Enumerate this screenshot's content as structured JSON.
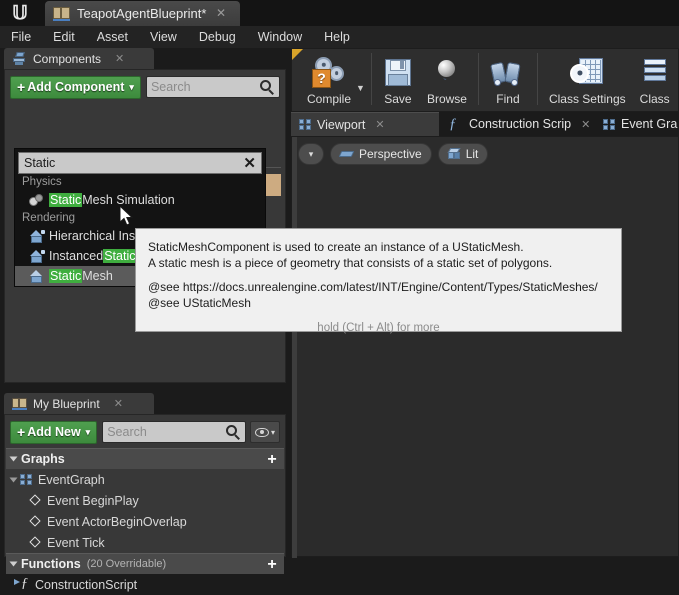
{
  "window": {
    "logo_icon": "unreal-logo",
    "tab": {
      "label": "TeapotAgentBlueprint*",
      "icon": "blueprint-icon",
      "close": "✕"
    }
  },
  "menubar": {
    "items": [
      "File",
      "Edit",
      "Asset",
      "View",
      "Debug",
      "Window",
      "Help"
    ]
  },
  "toolbar": {
    "items": [
      {
        "label": "Compile",
        "icon": "compile-gear-question-icon",
        "has_dropdown": true
      },
      {
        "label": "Save",
        "icon": "save-floppy-icon"
      },
      {
        "label": "Browse",
        "icon": "browse-magnifier-icon"
      },
      {
        "label": "Find",
        "icon": "find-binoculars-icon"
      },
      {
        "label": "Class Settings",
        "icon": "class-settings-gear-icon"
      },
      {
        "label": "Class",
        "icon": "class-defaults-stack-icon"
      }
    ]
  },
  "components_panel": {
    "tab_label": "Components",
    "tab_icon": "components-icon",
    "tab_close": "✕",
    "add_component_label": "Add Component",
    "add_component_plus": "+",
    "add_component_caret": "▾",
    "search_placeholder": "Search",
    "search_icon": "magnifier-icon",
    "dropdown": {
      "filter_value": "Static",
      "clear_label": "✕",
      "highlight_term": "Static",
      "groups": [
        {
          "category": "Physics",
          "entries": [
            {
              "icon": "mesh-simulation-icon",
              "pre": "",
              "hl": "Static",
              "post": " Mesh Simulation",
              "selected": false
            }
          ]
        },
        {
          "category": "Rendering",
          "entries": [
            {
              "icon": "instanced-static-mesh-icon",
              "pre": "Hierarchical Instanced ",
              "hl": "Static",
              "post": " Mesh",
              "selected": false
            },
            {
              "icon": "instanced-static-mesh-icon",
              "pre": "Instanced ",
              "hl": "Static",
              "post": " Mesh",
              "selected": false
            },
            {
              "icon": "static-mesh-icon",
              "pre": "",
              "hl": "Static",
              "post": " Mesh",
              "selected": true
            }
          ]
        }
      ]
    }
  },
  "tooltip": {
    "line1": "StaticMeshComponent is used to create an instance of a UStaticMesh.",
    "line2": "A static mesh is a piece of geometry that consists of a static set of polygons.",
    "line3": "@see https://docs.unrealengine.com/latest/INT/Engine/Content/Types/StaticMeshes/",
    "line4": "@see UStaticMesh",
    "hint": "hold (Ctrl + Alt) for more"
  },
  "viewport_tabs": {
    "tabs": [
      {
        "label": "Viewport",
        "icon": "viewport-grid-icon",
        "active": true,
        "close": "✕"
      },
      {
        "label": "Construction Scrip",
        "icon": "function-fx-icon",
        "active": false,
        "close": "✕"
      },
      {
        "label": "Event Gra",
        "icon": "event-graph-icon",
        "active": false,
        "close": ""
      }
    ]
  },
  "viewport_toolbar": {
    "menu_caret": "▾",
    "view_mode": "Perspective",
    "view_mode_icon": "perspective-icon",
    "lighting_mode": "Lit",
    "lighting_mode_icon": "lit-cube-icon"
  },
  "my_blueprint_panel": {
    "tab_label": "My Blueprint",
    "tab_icon": "blueprint-book-icon",
    "tab_close": "✕",
    "add_new_label": "Add New",
    "add_new_plus": "+",
    "add_new_caret": "▾",
    "search_placeholder": "Search",
    "search_icon": "magnifier-icon",
    "visibility_icon": "eye-icon",
    "visibility_caret": "▾",
    "sections": [
      {
        "title": "Graphs",
        "subtitle": "",
        "add_label": "+",
        "items": [
          {
            "label": "EventGraph",
            "icon": "event-graph-icon",
            "indent": 0,
            "expander": true
          },
          {
            "label": "Event BeginPlay",
            "icon": "event-node-icon",
            "indent": 1,
            "expander": false
          },
          {
            "label": "Event ActorBeginOverlap",
            "icon": "event-node-icon",
            "indent": 1,
            "expander": false
          },
          {
            "label": "Event Tick",
            "icon": "event-node-icon",
            "indent": 1,
            "expander": false
          }
        ]
      },
      {
        "title": "Functions",
        "subtitle": "(20 Overridable)",
        "add_label": "+",
        "items": [
          {
            "label": "ConstructionScript",
            "icon": "function-icon",
            "indent": 0,
            "expander": false
          }
        ]
      }
    ]
  },
  "colors": {
    "accent_green": "#3d8b3d",
    "highlight_green": "#3fae3f",
    "warning_orange": "#d9a42a",
    "panel_bg": "#383838",
    "window_bg": "#1b1b1b",
    "dropdown_bg": "#131313"
  }
}
